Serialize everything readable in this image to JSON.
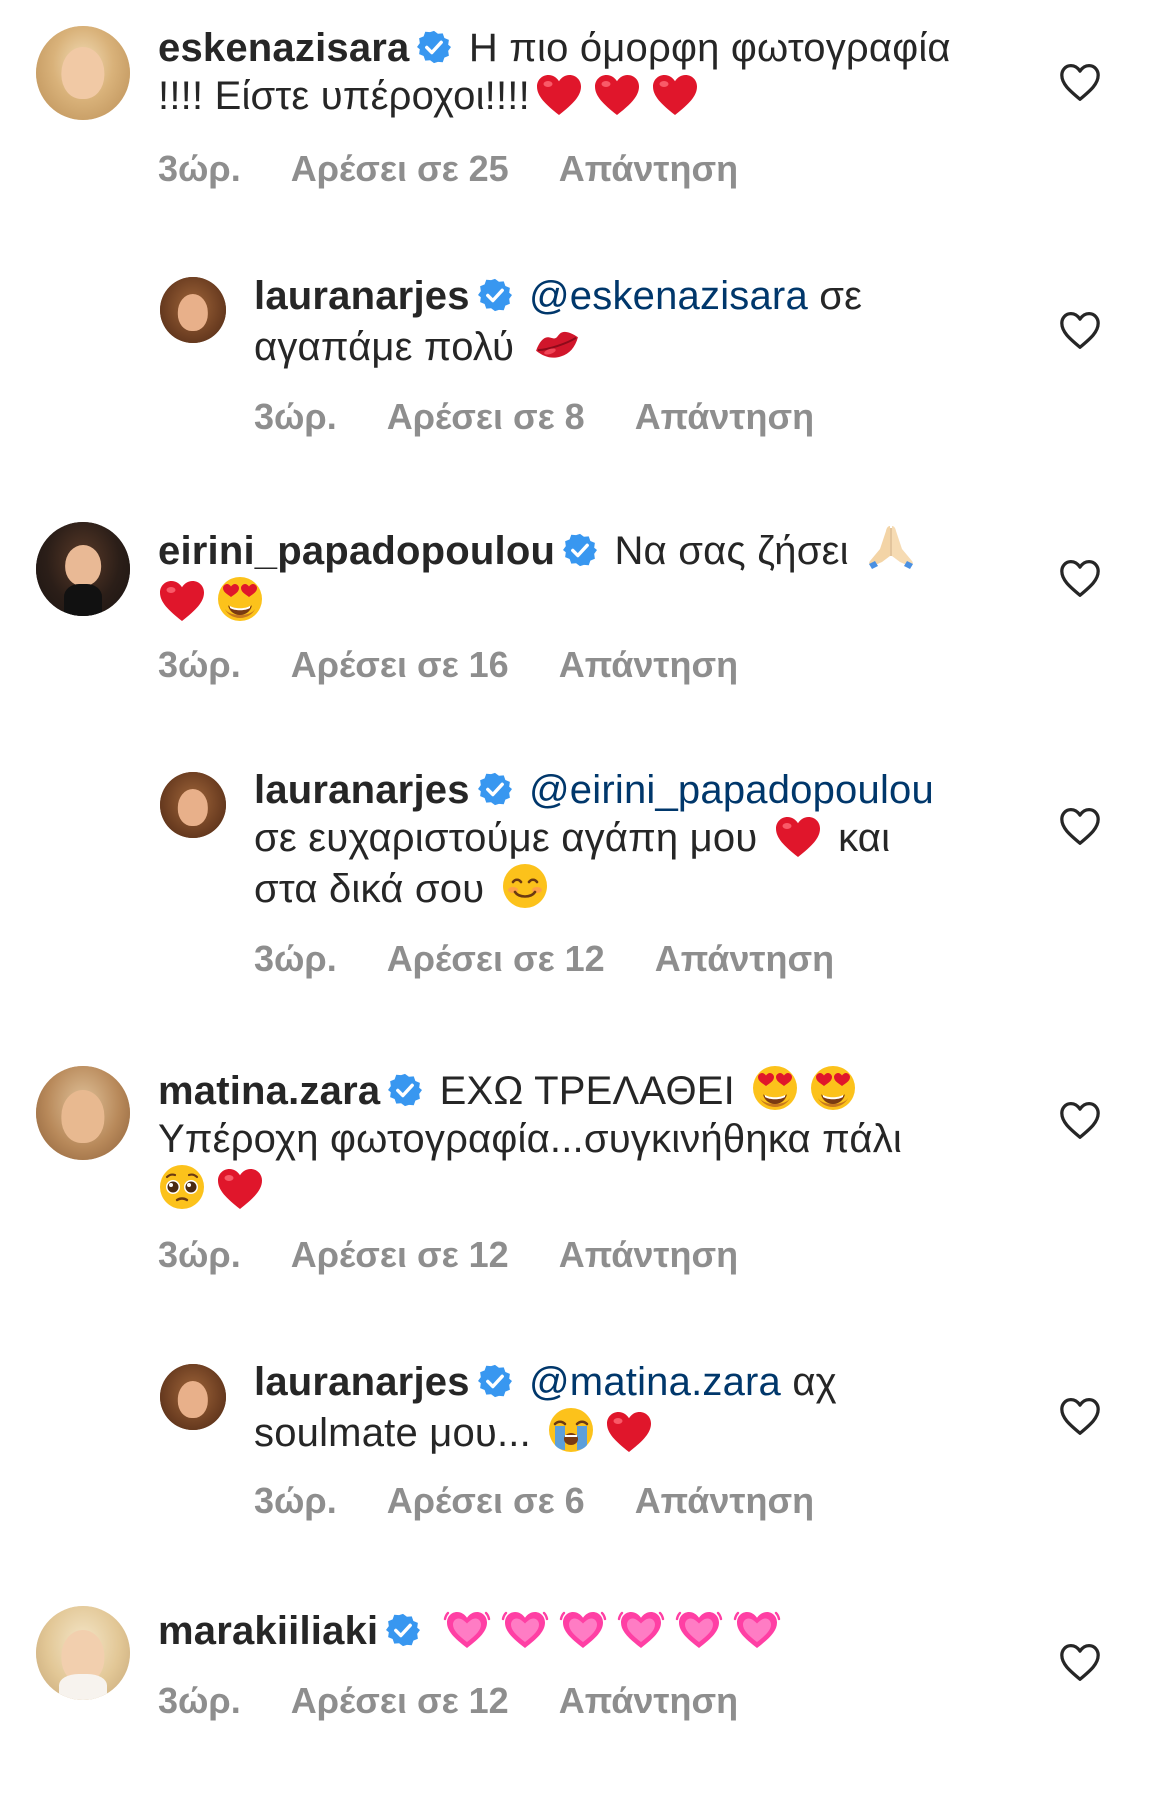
{
  "comments": [
    {
      "username": "eskenazisara",
      "text": "Η πιο όμορφη φωτογραφία",
      "text_line2": "!!!! Είστε υπέροχοι!!!!",
      "time": "3ώρ.",
      "likes": "Αρέσει σε 25",
      "reply": "Απάντηση"
    },
    {
      "username": "lauranarjes",
      "mention": "@eskenazisara",
      "text": " σε",
      "text_line2": "αγαπάμε πολύ",
      "time": "3ώρ.",
      "likes": "Αρέσει σε 8",
      "reply": "Απάντηση"
    },
    {
      "username": "eirini_papadopoulou",
      "text": "Να σας ζήσει",
      "time": "3ώρ.",
      "likes": "Αρέσει σε 16",
      "reply": "Απάντηση"
    },
    {
      "username": "lauranarjes",
      "mention": "@eirini_papadopoulou",
      "text": "σε ευχαριστούμε αγάπη μου",
      "text_b": "και",
      "text_line3": "στα δικά σου",
      "time": "3ώρ.",
      "likes": "Αρέσει σε 12",
      "reply": "Απάντηση"
    },
    {
      "username": "matina.zara",
      "text": "ΕΧΩ ΤΡΕΛΑΘΕΙ",
      "text_line2": "Υπέροχη φωτογραφία...συγκινήθηκα πάλι",
      "time": "3ώρ.",
      "likes": "Αρέσει σε 12",
      "reply": "Απάντηση"
    },
    {
      "username": "lauranarjes",
      "mention": "@matina.zara",
      "text": " αχ",
      "text_line2": "soulmate μου...",
      "time": "3ώρ.",
      "likes": "Αρέσει σε 6",
      "reply": "Απάντηση"
    },
    {
      "username": "marakiiliaki",
      "time": "3ώρ.",
      "likes": "Αρέσει σε 12",
      "reply": "Απάντηση"
    }
  ],
  "icons": {
    "verified": "verified-badge-icon",
    "like": "heart-outline-icon",
    "red_heart": "red-heart-emoji",
    "kiss": "kiss-mark-emoji",
    "pray": "folded-hands-emoji",
    "heart_eyes": "heart-eyes-emoji",
    "smile": "smiling-face-emoji",
    "pleading": "pleading-face-emoji",
    "crying": "loudly-crying-face-emoji",
    "pink_heart": "growing-heart-emoji"
  },
  "colors": {
    "verified": "#3897f0",
    "mention": "#00376b",
    "meta": "#8e8e8e",
    "heart_red": "#e0162b",
    "pink_heart": "#ff3fa4"
  }
}
